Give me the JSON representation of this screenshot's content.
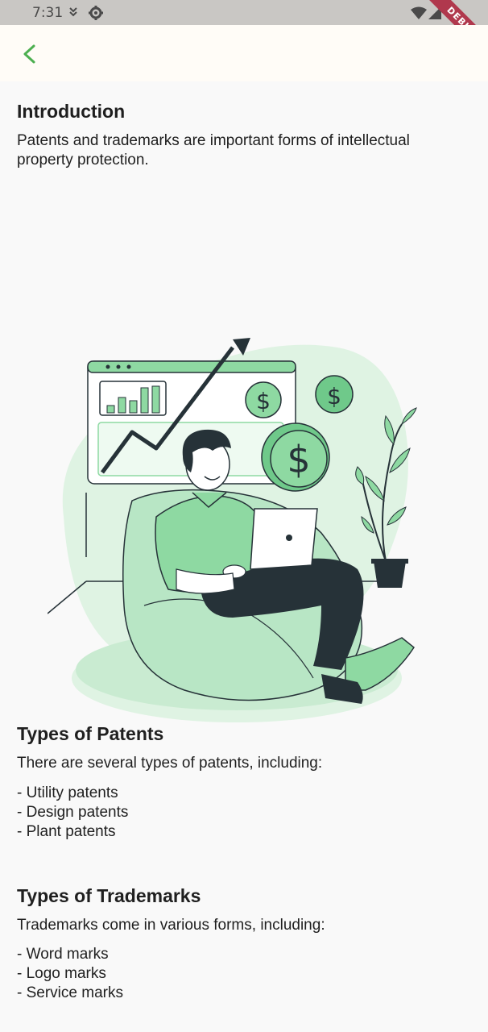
{
  "status": {
    "time": "7:31",
    "debug": "DEBUG"
  },
  "intro": {
    "title": "Introduction",
    "text": "Patents and trademarks are important forms of intellectual property protection."
  },
  "patents": {
    "title": "Types of Patents",
    "text": "There are several types of patents, including:",
    "items": [
      "- Utility patents",
      "- Design patents",
      "- Plant patents"
    ]
  },
  "trademarks": {
    "title": "Types of Trademarks",
    "text": "Trademarks come in various forms, including:",
    "items": [
      "- Word marks",
      "- Logo marks",
      "- Service marks"
    ]
  },
  "colors": {
    "accent": "#4caf50",
    "illustration_green": "#8ed9a2",
    "illustration_light": "#dff3e3",
    "ink": "#263238"
  },
  "icons": {
    "back": "back-arrow-icon",
    "status": [
      "download-icon",
      "settings-icon",
      "wifi-icon",
      "signal-icon"
    ]
  }
}
